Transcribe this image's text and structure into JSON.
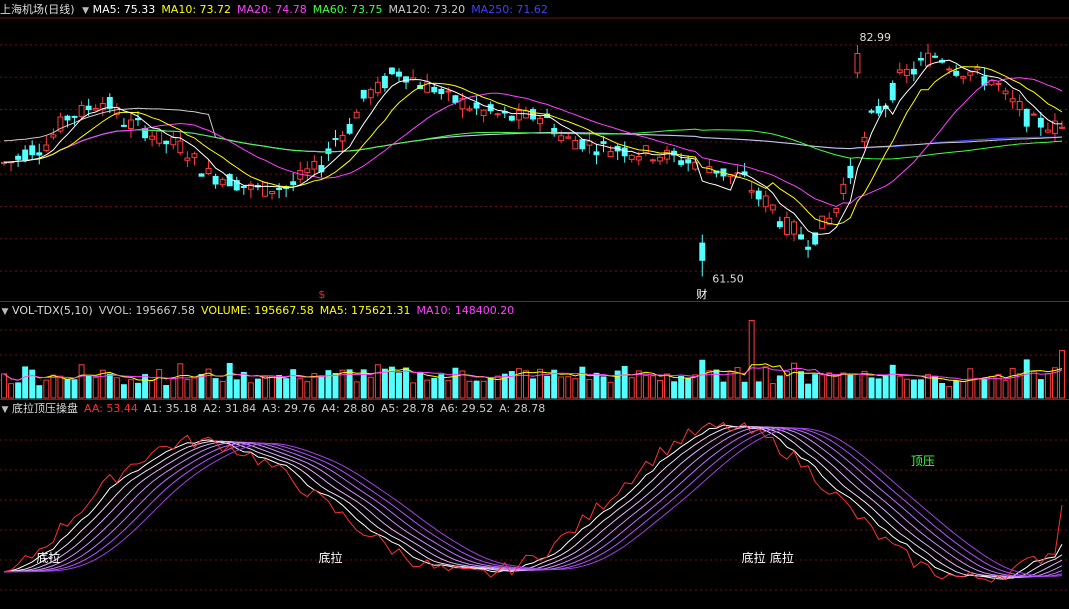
{
  "price_panel": {
    "title": "上海机场(日线)",
    "indicators": [
      {
        "label": "MA5: 75.33",
        "color": "#ffffff"
      },
      {
        "label": "MA10: 73.72",
        "color": "#ffff00"
      },
      {
        "label": "MA20: 74.78",
        "color": "#ff40ff"
      },
      {
        "label": "MA60: 73.75",
        "color": "#40ff40"
      },
      {
        "label": "MA120: 73.20",
        "color": "#cccccc"
      },
      {
        "label": "MA250: 71.62",
        "color": "#4040ff"
      }
    ],
    "high_marker": "82.99",
    "low_marker": "61.50",
    "dollar_marker": "$",
    "cai_marker": "财"
  },
  "volume_panel": {
    "title": "VOL-TDX(5,10)",
    "indicators": [
      {
        "label": "VVOL: 195667.58",
        "color": "#cccccc"
      },
      {
        "label": "VOLUME: 195667.58",
        "color": "#ffff00"
      },
      {
        "label": "MA5: 175621.31",
        "color": "#ffff00"
      },
      {
        "label": "MA10: 148400.20",
        "color": "#ff40ff"
      }
    ]
  },
  "osc_panel": {
    "title": "底拉顶压操盘",
    "indicators": [
      {
        "label": "AA: 53.44",
        "color": "#ff3030"
      },
      {
        "label": "A1: 35.18",
        "color": "#cccccc"
      },
      {
        "label": "A2: 31.84",
        "color": "#cccccc"
      },
      {
        "label": "A3: 29.76",
        "color": "#cccccc"
      },
      {
        "label": "A4: 28.80",
        "color": "#cccccc"
      },
      {
        "label": "A5: 28.78",
        "color": "#cccccc"
      },
      {
        "label": "A6: 29.52",
        "color": "#cccccc"
      },
      {
        "label": "A: 28.78",
        "color": "#cccccc"
      }
    ],
    "labels": [
      {
        "text": "底拉",
        "bar": 6,
        "color": "#ffffff"
      },
      {
        "text": "底拉",
        "bar": 46,
        "color": "#ffffff"
      },
      {
        "text": "底拉",
        "bar": 106,
        "color": "#ffffff"
      },
      {
        "text": "底拉",
        "bar": 110,
        "color": "#ffffff"
      },
      {
        "text": "顶压",
        "bar": 130,
        "color": "#40ff40"
      }
    ]
  },
  "chart_data": {
    "type": "candlestick",
    "price_range": [
      59.5,
      85.5
    ],
    "volume_max": 330000,
    "osc_range": [
      0,
      100
    ],
    "bars": 151,
    "cai_bar": 99,
    "dollar_bar": 45,
    "volume_last": 195667.58,
    "ma_last": {
      "MA5": 75.33,
      "MA10": 73.72,
      "MA20": 74.78,
      "MA60": 73.75,
      "MA120": 73.2,
      "MA250": 71.62
    }
  }
}
